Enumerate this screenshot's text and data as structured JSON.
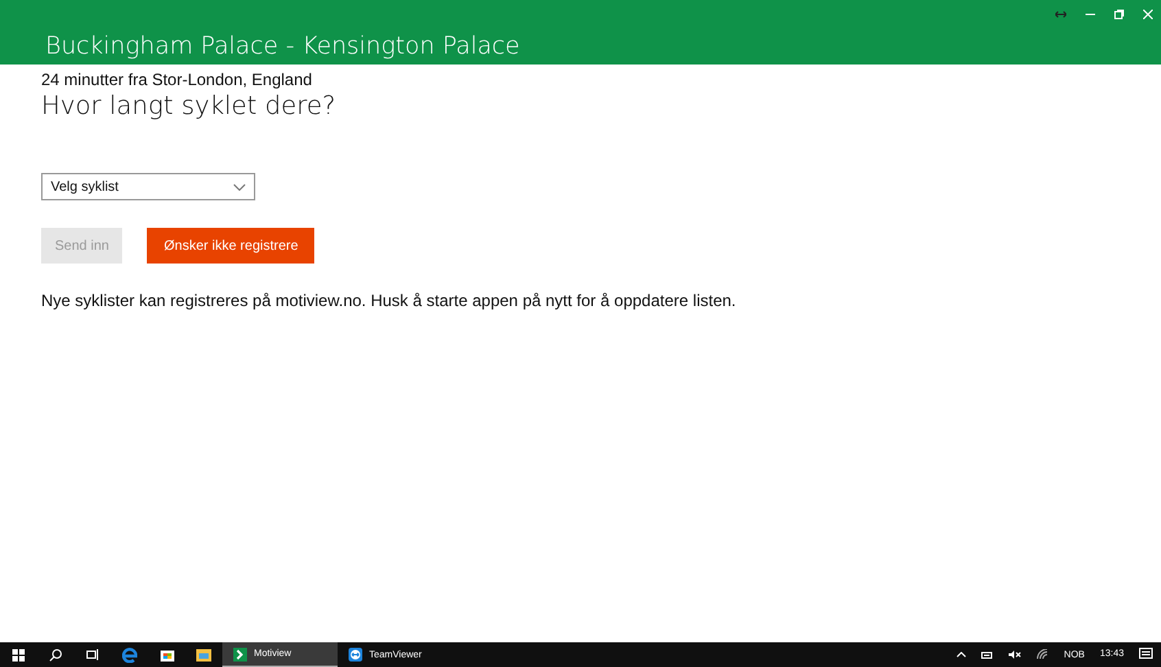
{
  "window": {
    "title": "Buckingham Palace - Kensington Palace"
  },
  "subtitle": "24 minutter fra Stor-London, England",
  "heading": "Hvor langt syklet dere?",
  "dropdown": {
    "value": "Velg syklist"
  },
  "buttons": [
    {
      "label": "Send inn",
      "kind": "secondary",
      "disabled": true
    },
    {
      "label": "Ønsker ikke registrere",
      "kind": "primary",
      "disabled": false
    }
  ],
  "note": "Nye syklister kan registreres på motiview.no. Husk å starte appen på nytt for å oppdatere listen.",
  "taskbar": {
    "apps": [
      {
        "label": "Motiview",
        "kind": "motiview",
        "selected": true
      },
      {
        "label": "TeamViewer",
        "kind": "teamviewer",
        "selected": false
      }
    ],
    "language": "NOB",
    "time": "13:43"
  }
}
